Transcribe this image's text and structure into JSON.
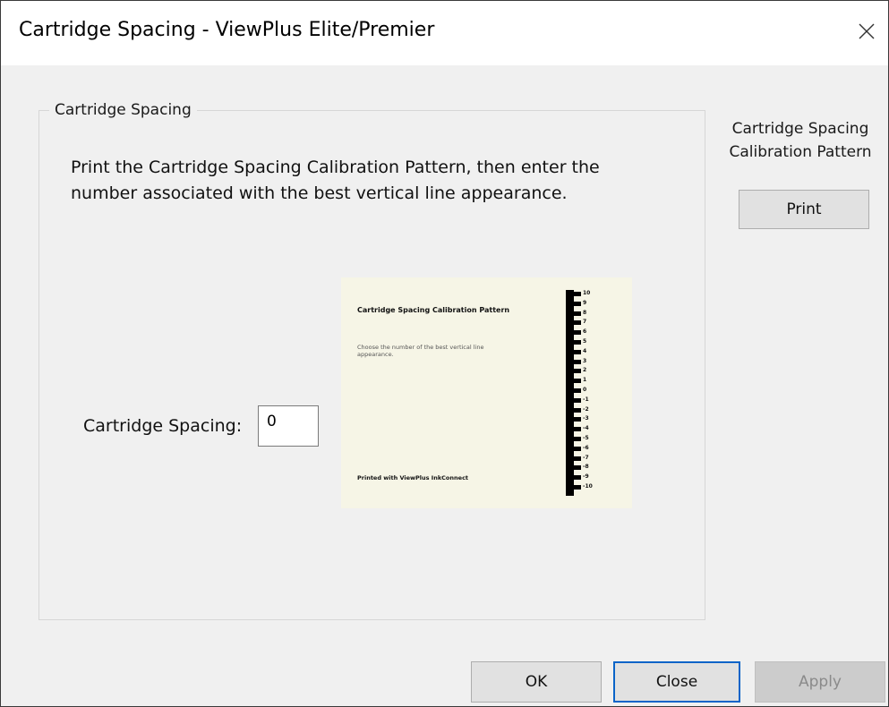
{
  "window": {
    "title": "Cartridge Spacing - ViewPlus Elite/Premier",
    "close_icon": "close-icon"
  },
  "group": {
    "label": "Cartridge Spacing",
    "instructions": "Print the Cartridge Spacing Calibration Pattern, then enter the number associated with the best vertical line appearance.",
    "spacing_label": "Cartridge Spacing:",
    "spacing_value": "0"
  },
  "preview": {
    "title": "Cartridge Spacing Calibration Pattern",
    "subtitle": "Choose the number of the best vertical line appearance.",
    "footer": "Printed with ViewPlus InkConnect",
    "scale": [
      "10",
      "9",
      "8",
      "7",
      "6",
      "5",
      "4",
      "3",
      "2",
      "1",
      "0",
      "-1",
      "-2",
      "-3",
      "-4",
      "-5",
      "-6",
      "-7",
      "-8",
      "-9",
      "-10"
    ]
  },
  "side": {
    "label": "Cartridge Spacing Calibration Pattern",
    "print_label": "Print"
  },
  "buttons": {
    "ok": "OK",
    "close": "Close",
    "apply": "Apply"
  },
  "colors": {
    "focus_border": "#0a64c8",
    "dialog_bg": "#f0f0f0",
    "preview_bg": "#f6f5e6"
  }
}
